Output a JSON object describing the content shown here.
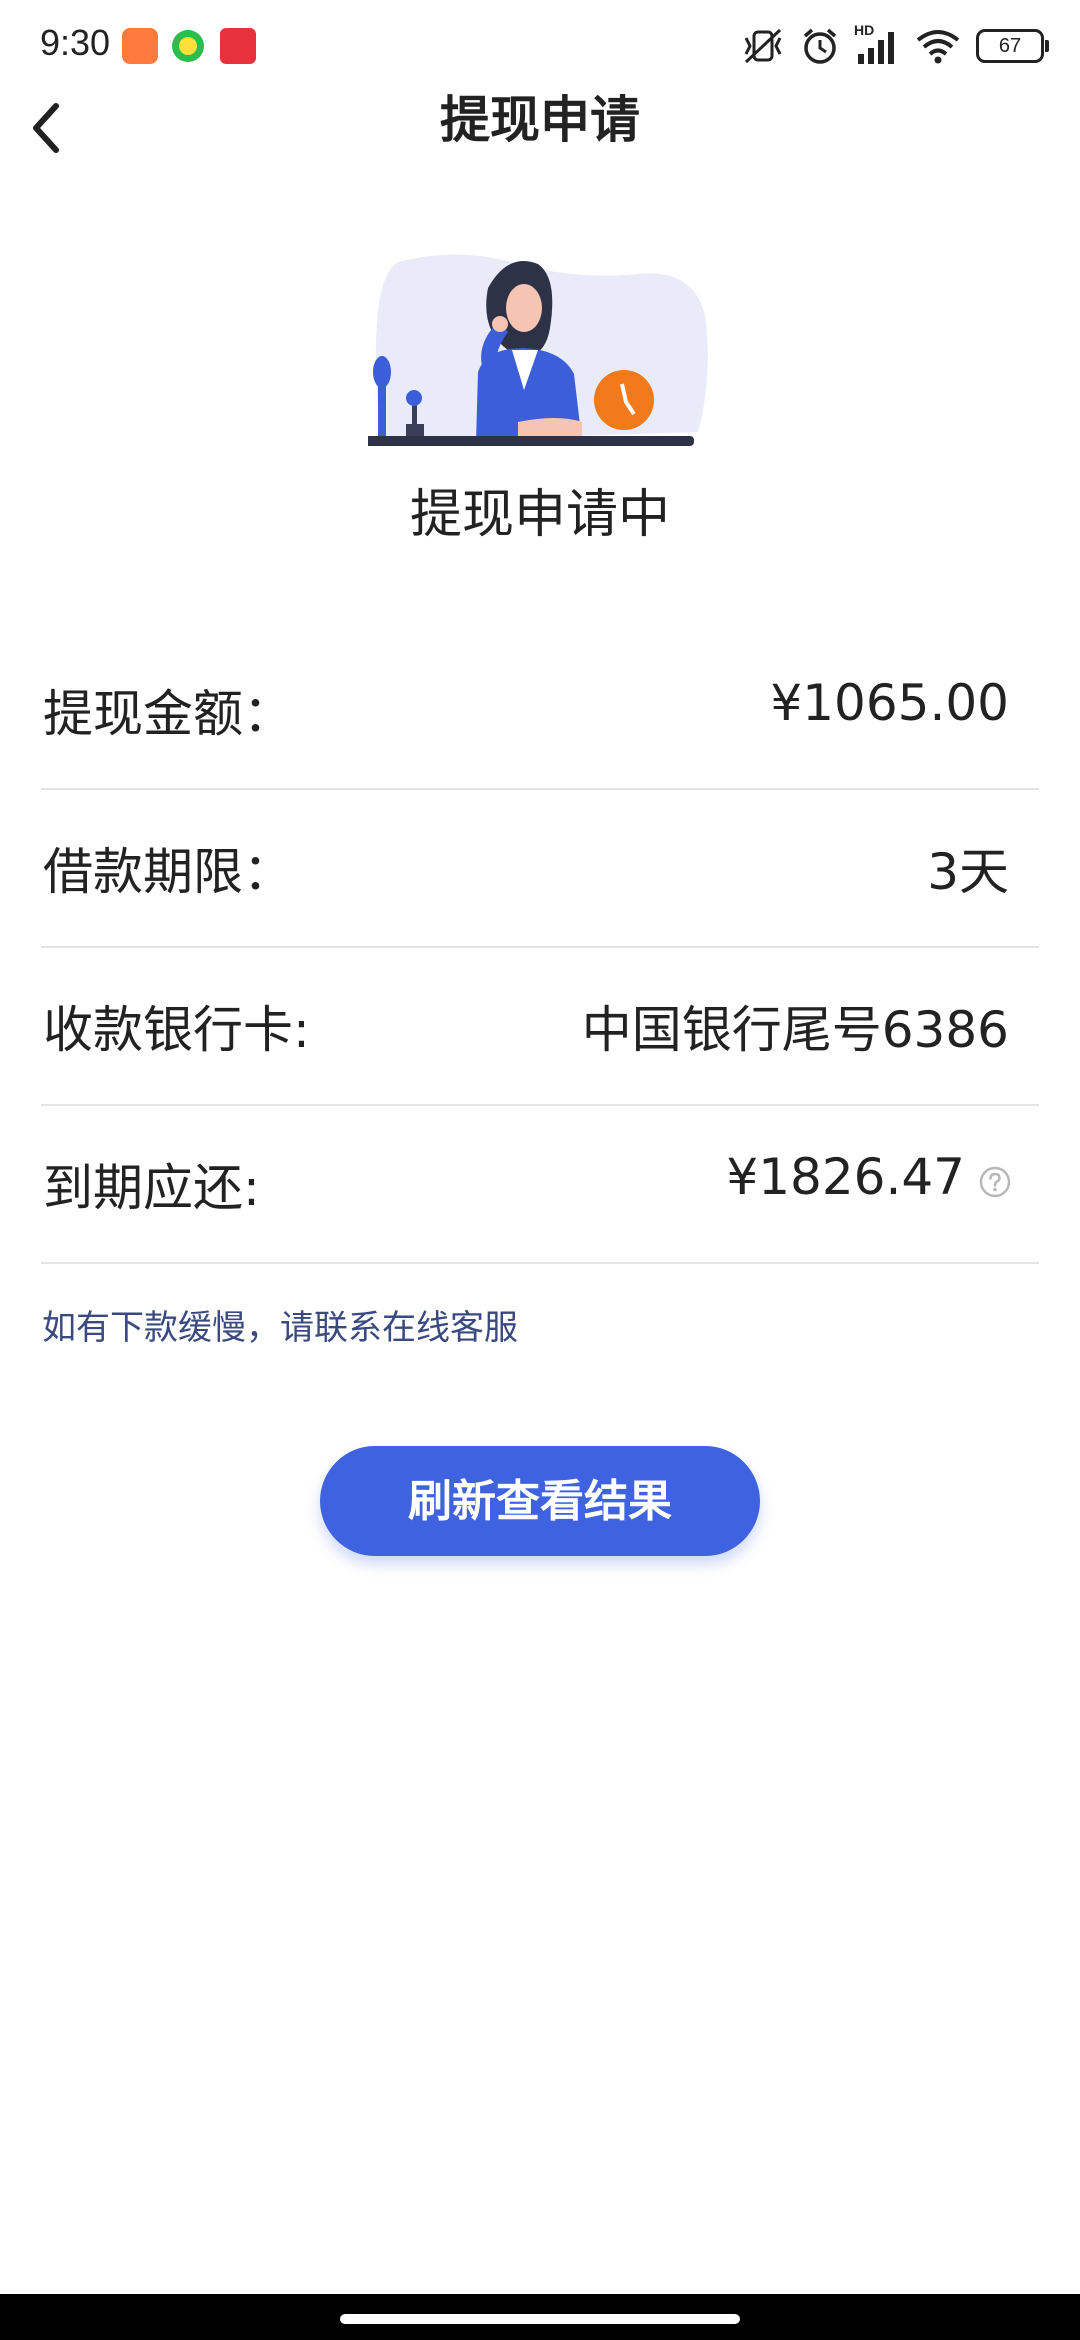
{
  "status_bar": {
    "time": "9:30",
    "battery": "67",
    "signal_label": "HD"
  },
  "header": {
    "title": "提现申请"
  },
  "status": {
    "title": "提现申请中"
  },
  "rows": [
    {
      "label": "提现金额：",
      "value": "¥1065.00"
    },
    {
      "label": "借款期限：",
      "value": "3天"
    },
    {
      "label": "收款银行卡:",
      "value": "中国银行尾号6386"
    },
    {
      "label": "到期应还:",
      "value": "¥1826.47"
    }
  ],
  "hint": "如有下款缓慢，请联系在线客服",
  "refresh_button": "刷新查看结果",
  "colors": {
    "accent": "#3f62e0",
    "hint": "#3a4a80",
    "divider": "#e5e5e5",
    "illustration_orange": "#f27a1a"
  }
}
